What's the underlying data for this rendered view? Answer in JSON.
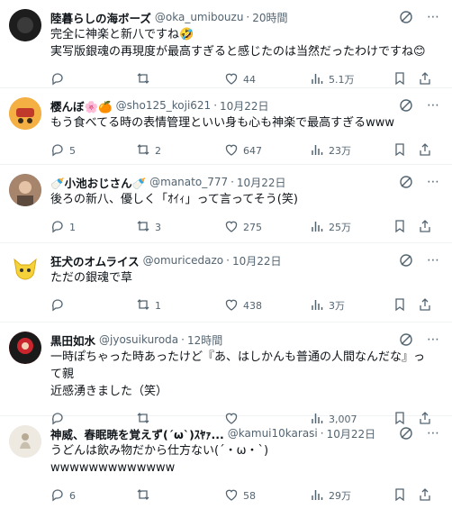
{
  "tweets": [
    {
      "name": "陸暮らしの海ボーズ",
      "handle": "@oka_umibouzu",
      "time": "20時間",
      "lines": [
        "完全に神楽と新八ですね🤣",
        "実写版銀魂の再現度が最高すぎると感じたのは当然だったわけですね😊"
      ],
      "replies": "",
      "retweets": "",
      "likes": "44",
      "views": "5.1万",
      "avatar_color": "#2b2b2b"
    },
    {
      "name": "樱んぼ🌸🍊",
      "handle": "@sho125_koji621",
      "time": "10月22日",
      "lines": [
        "もう食べてる時の表情管理といい身も心も神楽で最高すぎるwww"
      ],
      "replies": "5",
      "retweets": "2",
      "likes": "647",
      "views": "23万",
      "avatar_color": "#f0a02a"
    },
    {
      "name": "🍼小池おじさん🍼",
      "handle": "@manato_777",
      "time": "10月22日",
      "lines": [
        "後ろの新八、優しく「ｵｲｨ」って言ってそう(笑)"
      ],
      "replies": "1",
      "retweets": "3",
      "likes": "275",
      "views": "25万",
      "avatar_color": "#8a6a55"
    },
    {
      "name": "狂犬のオムライス",
      "handle": "@omuricedazo",
      "time": "10月22日",
      "lines": [
        "ただの銀魂で草"
      ],
      "replies": "",
      "retweets": "1",
      "likes": "438",
      "views": "3万",
      "avatar_color": "#f5d23a"
    },
    {
      "name": "黒田如水",
      "handle": "@jyosuikuroda",
      "time": "12時間",
      "lines": [
        "一時ぽちゃった時あったけど『あ、はしかんも普通の人間なんだな』って親",
        "近感湧きました（笑）"
      ],
      "replies": "",
      "retweets": "",
      "likes": "",
      "views": "3,007",
      "avatar_color": "#c8262c"
    },
    {
      "name": "神威、春眠暁を覚えず(´ω`)ｽﾔｧ...",
      "handle": "@kamui10karasi",
      "time": "10月22日",
      "lines": [
        "うどんは飲み物だから仕方ない(´・ω・`)",
        "wwwwwwwwwwwww"
      ],
      "replies": "6",
      "retweets": "",
      "likes": "58",
      "views": "29万",
      "avatar_color": "#e9e4dc"
    }
  ]
}
